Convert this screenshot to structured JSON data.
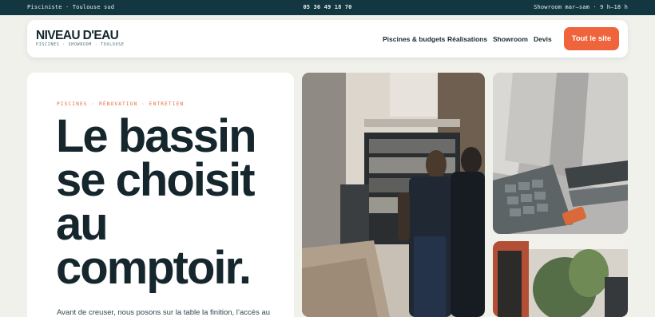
{
  "topbar": {
    "left": "Pisciniste · Toulouse sud",
    "phone": "05 36 49 18 70",
    "hours": "Showroom mar–sam · 9 h–18 h"
  },
  "brand": {
    "name": "NIVEAU D'EAU",
    "tagline": "PISCINES · SHOWROOM · TOULOUSE"
  },
  "nav": {
    "items": [
      "Piscines & budgets",
      "Réalisations",
      "Showroom",
      "Devis"
    ],
    "cta": "Tout le site"
  },
  "hero": {
    "kicker": "PISCINES · RÉNOVATION · ENTRETIEN",
    "headline": [
      "Le bassin",
      "se choisit",
      "au",
      "comptoir."
    ],
    "lead": "Avant de creuser, nous posons sur la table la finition, l’accès au"
  },
  "colors": {
    "topbar": "#123740",
    "accent": "#f0643b",
    "ink": "#15262d",
    "background": "#f1f1ec"
  },
  "icons": [
    "showroom-photo",
    "materials-photo",
    "garden-photo"
  ]
}
